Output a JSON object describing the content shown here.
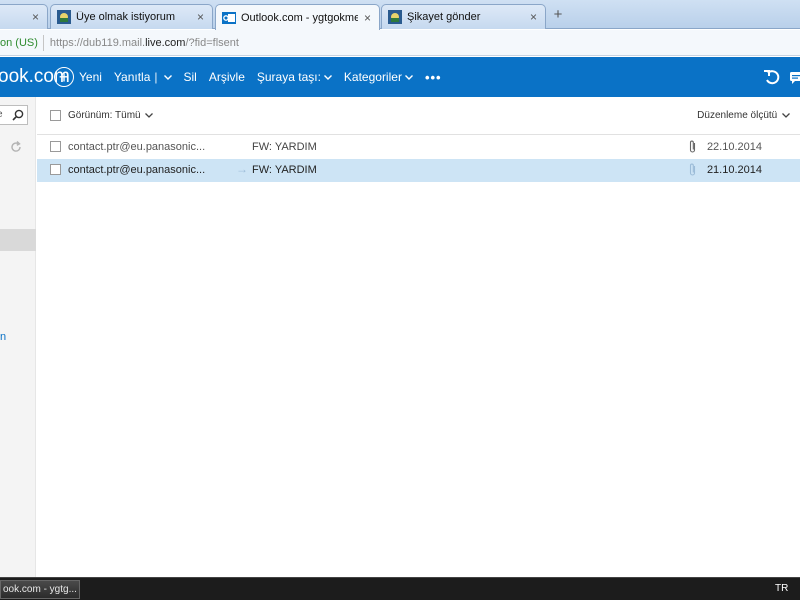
{
  "browser": {
    "tabs": [
      {
        "title": "",
        "active": false,
        "close": "×"
      },
      {
        "title": "Üye olmak istiyorum",
        "active": false,
        "close": "×"
      },
      {
        "title": "Outlook.com - ygtgokmen...",
        "active": true,
        "close": "×"
      },
      {
        "title": "Şikayet gönder",
        "active": false,
        "close": "×"
      }
    ],
    "new_tab": "+",
    "cert_label": "on (US)",
    "url_prefix": "https://dub119.mail.",
    "url_domain": "live.com",
    "url_suffix": "/?fid=flsent"
  },
  "header": {
    "brand": "ook.com",
    "commands": {
      "new": "Yeni",
      "reply": "Yanıtla",
      "reply_sep": "|",
      "delete": "Sil",
      "archive": "Arşivle",
      "move": "Şuraya taşı:",
      "categories": "Kategoriler",
      "more": "•••"
    },
    "accent": "#0a72c6"
  },
  "sidebar": {
    "search_fragment": "e",
    "folder_fragment": "n"
  },
  "list": {
    "view_filter": "Görünüm: Tümü",
    "sort_label": "Düzenleme ölçütü",
    "messages": [
      {
        "from": "contact.ptr@eu.panasonic...",
        "subject": "FW: YARDIM",
        "date": "22.10.2014",
        "attachment": true,
        "selected": false,
        "forward_arrow": ""
      },
      {
        "from": "contact.ptr@eu.panasonic...",
        "subject": "FW: YARDIM",
        "date": "21.10.2014",
        "attachment": true,
        "selected": true,
        "forward_arrow": "→"
      }
    ]
  },
  "taskbar": {
    "task": "ook.com - ygtg...",
    "language": "TR"
  }
}
